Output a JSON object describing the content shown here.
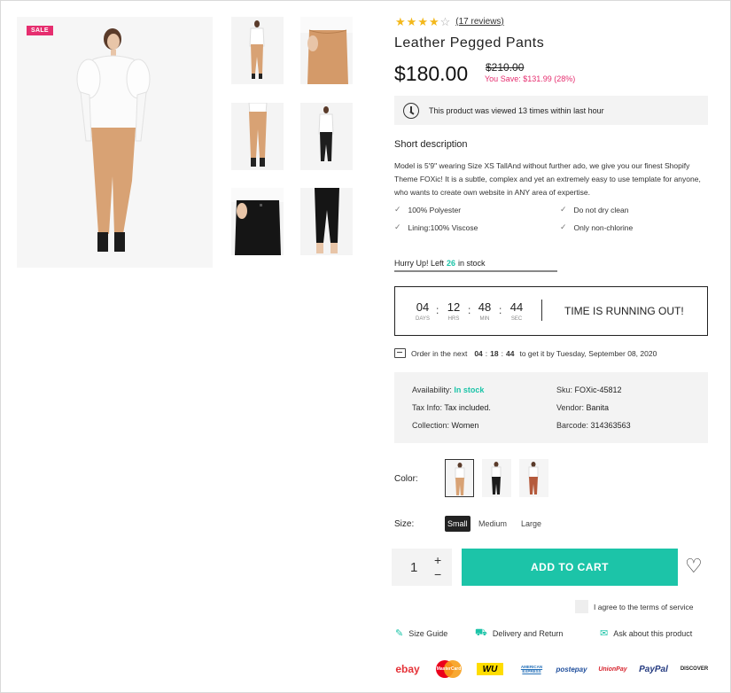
{
  "product": {
    "sale_badge": "SALE",
    "rating": 4,
    "reviews": "(17 reviews)",
    "title": "Leather Pegged Pants",
    "price": "$180.00",
    "old_price": "$210.00",
    "you_save": "You Save: $131.99 (28%)",
    "viewed_text": "This product was viewed 13 times within last hour"
  },
  "short_description": {
    "heading": "Short description",
    "text": "Model is 5'9\" wearing Size XS TallAnd without further ado, we give you our finest Shopify Theme FOXic! It is a subtle, complex and yet an extremely easy to use template for anyone, who wants to create own website in ANY area of expertise.",
    "features": [
      "100% Polyester",
      "Do not dry clean",
      "Lining:100% Viscose",
      "Only non-chlorine"
    ]
  },
  "stock": {
    "prefix": "Hurry Up! Left",
    "count": "26",
    "suffix": "in stock",
    "level": 0.52
  },
  "countdown": {
    "days": "04",
    "hrs": "12",
    "min": "48",
    "sec": "44",
    "days_label": "DAYS",
    "hrs_label": "HRS",
    "min_label": "MIN",
    "sec_label": "SEC",
    "message": "TIME IS RUNNING OUT!"
  },
  "order": {
    "prefix": "Order in the next",
    "h": "04",
    "m": "18",
    "s": "44",
    "suffix": "to get it by Tuesday, September 08, 2020"
  },
  "meta": {
    "availability_label": "Availability:",
    "availability_value": "In stock",
    "sku_label": "Sku:",
    "sku_value": "FOXic-45812",
    "tax_label": "Tax Info:",
    "tax_value": "Tax included.",
    "vendor_label": "Vendor:",
    "vendor_value": "Banita",
    "collection_label": "Collection:",
    "collection_value": "Women",
    "barcode_label": "Barcode:",
    "barcode_value": "314363563"
  },
  "options": {
    "color_label": "Color:",
    "size_label": "Size:",
    "sizes": [
      "Small",
      "Medium",
      "Large"
    ]
  },
  "cart": {
    "quantity": "1",
    "plus": "+",
    "minus": "−",
    "add_label": "ADD TO CART"
  },
  "terms": "I agree to the terms of service",
  "links": {
    "size_guide": "Size Guide",
    "delivery": "Delivery and Return",
    "ask": "Ask about this product"
  },
  "payments": [
    "ebay",
    "MasterCard",
    "WU",
    "AMERICAN EXPRESS",
    "postepay",
    "UnionPay",
    "PayPal",
    "DISCOVER"
  ],
  "colors": {
    "accent": "#1cc4a8",
    "sale": "#e62e6f",
    "star": "#f3b81b"
  }
}
